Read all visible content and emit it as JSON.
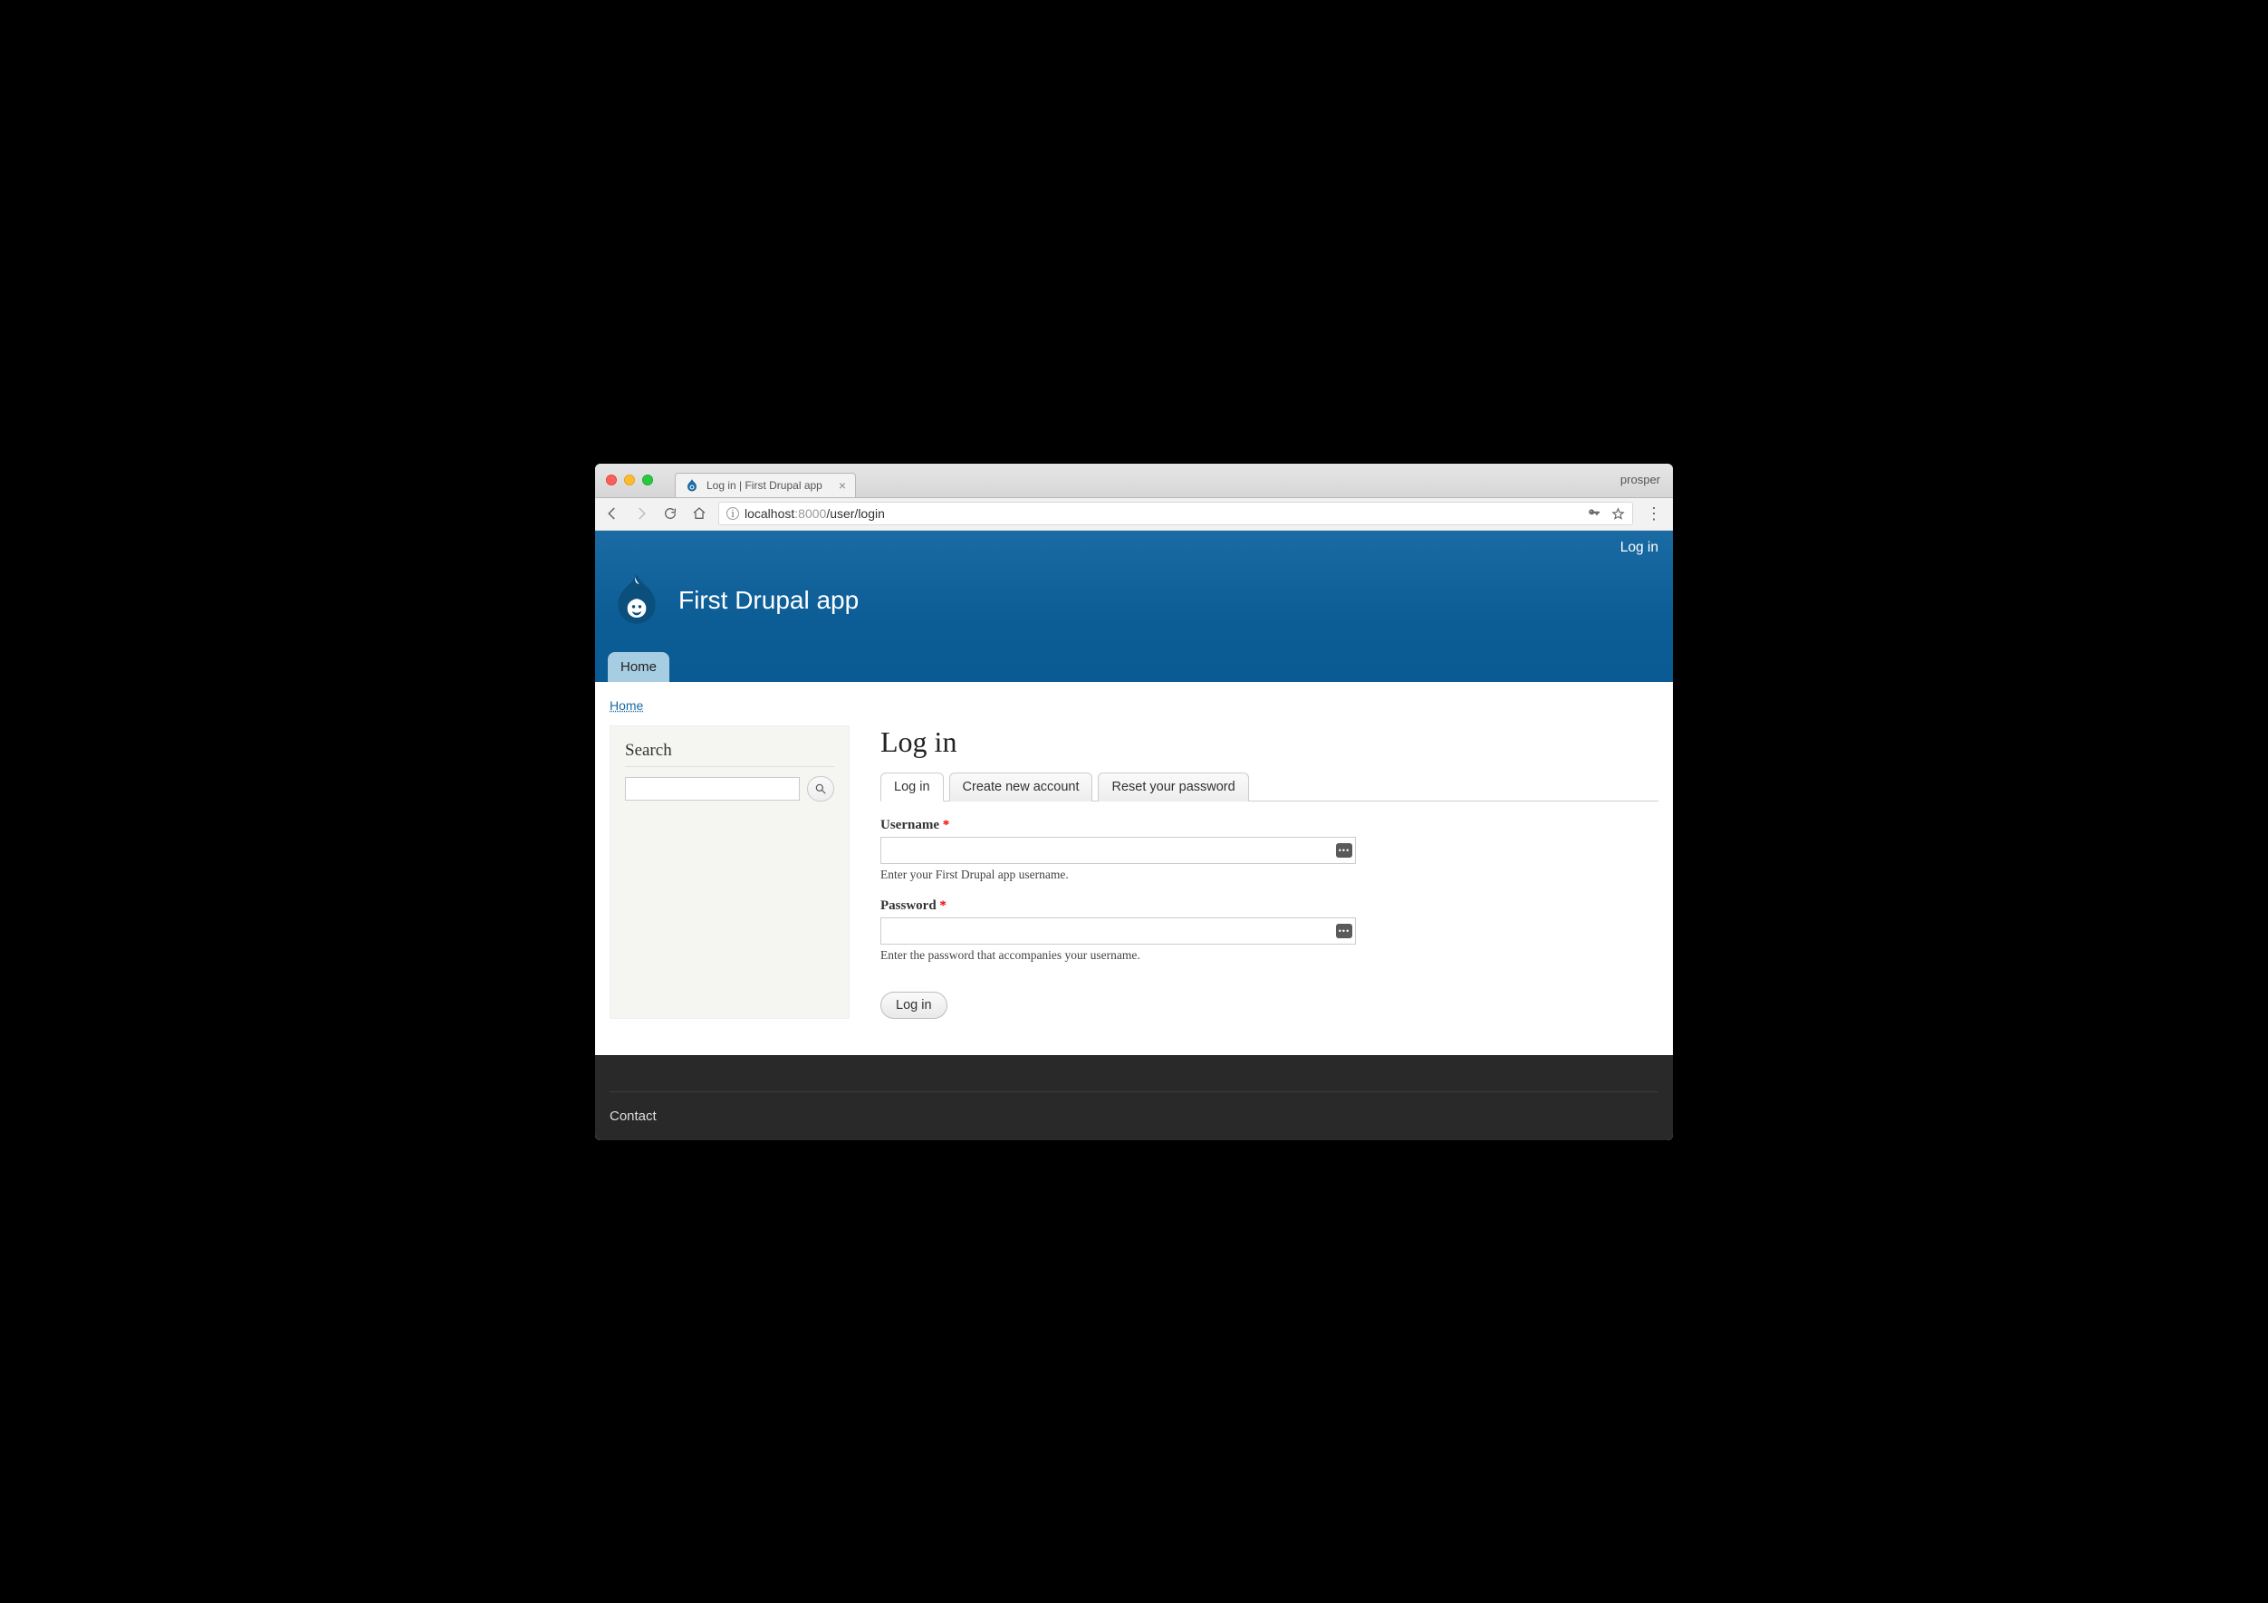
{
  "browser": {
    "tab_title": "Log in | First Drupal app",
    "profile": "prosper",
    "url_host": "localhost",
    "url_port": ":8000",
    "url_path": "/user/login"
  },
  "header": {
    "login_link": "Log in",
    "site_name": "First Drupal app",
    "menu": {
      "home": "Home"
    }
  },
  "breadcrumb": {
    "home": "Home"
  },
  "sidebar": {
    "search_heading": "Search"
  },
  "main": {
    "title": "Log in",
    "tabs": {
      "login": "Log in",
      "create": "Create new account",
      "reset": "Reset your password"
    },
    "form": {
      "username_label": "Username",
      "username_desc": "Enter your First Drupal app username.",
      "password_label": "Password",
      "password_desc": "Enter the password that accompanies your username.",
      "required_mark": "*",
      "submit": "Log in"
    }
  },
  "footer": {
    "contact": "Contact"
  }
}
